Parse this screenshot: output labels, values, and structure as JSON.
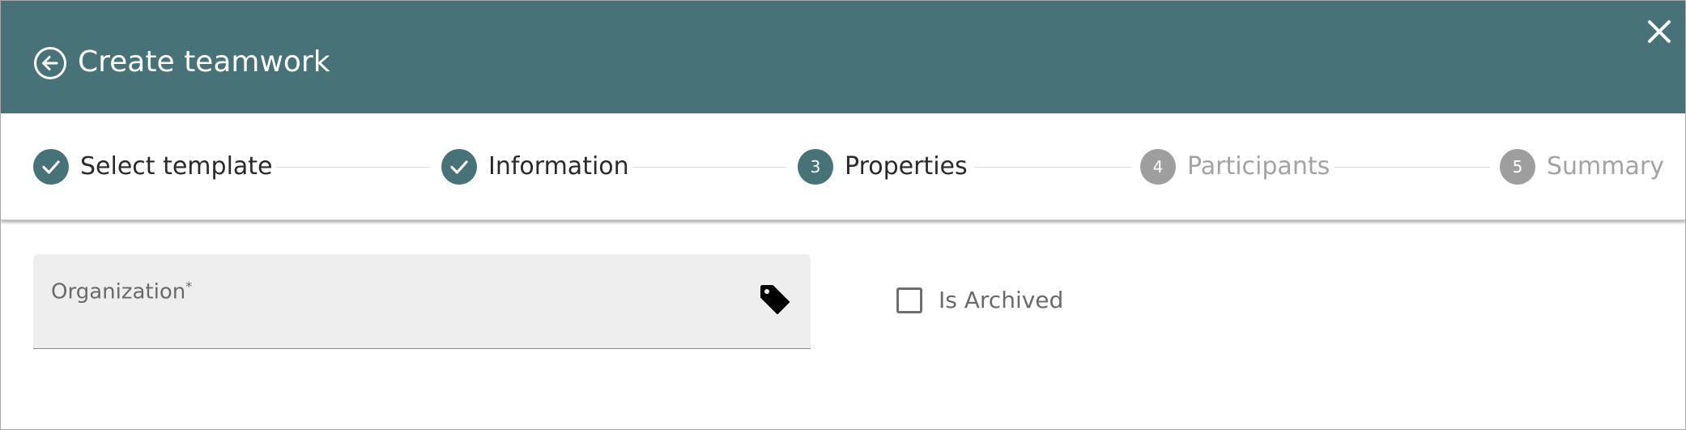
{
  "dialog": {
    "title": "Create teamwork",
    "back_icon": "arrow-left-circle-icon",
    "close_icon": "close-icon",
    "header_color": "#477378"
  },
  "stepper": {
    "steps": [
      {
        "number": "1",
        "label": "Select template",
        "status": "completed",
        "icon": "check-icon"
      },
      {
        "number": "2",
        "label": "Information",
        "status": "completed",
        "icon": "check-icon"
      },
      {
        "number": "3",
        "label": "Properties",
        "status": "active"
      },
      {
        "number": "4",
        "label": "Participants",
        "status": "pending"
      },
      {
        "number": "5",
        "label": "Summary",
        "status": "pending"
      }
    ],
    "active_color": "#477378",
    "pending_color": "#9e9e9e"
  },
  "form": {
    "organization": {
      "label": "Organization",
      "required_marker": "*",
      "value": "",
      "icon": "tag-icon"
    },
    "is_archived": {
      "label": "Is Archived",
      "checked": false
    }
  }
}
